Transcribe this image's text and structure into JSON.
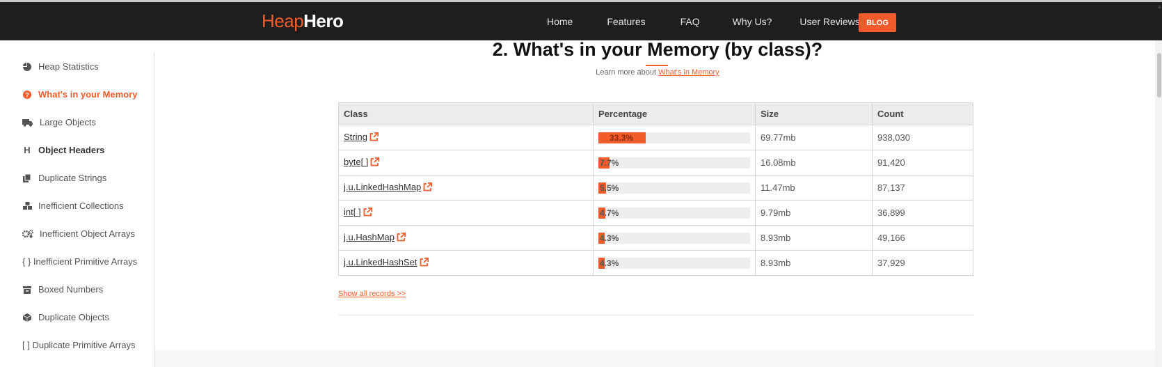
{
  "brand": {
    "part1": "Heap",
    "part2": "Hero"
  },
  "nav": {
    "items": [
      "Home",
      "Features",
      "FAQ",
      "Why Us?",
      "User Reviews"
    ],
    "blog": "BLOG"
  },
  "sidebar": {
    "items": [
      {
        "label": "Heap Statistics",
        "icon": "pie-chart-icon"
      },
      {
        "label": "What's in your Memory",
        "icon": "question-circle-icon",
        "active": true
      },
      {
        "label": "Large Objects",
        "icon": "truck-icon"
      },
      {
        "label": "Object Headers",
        "icon": "header-icon"
      },
      {
        "label": "Duplicate Strings",
        "icon": "copy-icon"
      },
      {
        "label": "Inefficient Collections",
        "icon": "cubes-icon"
      },
      {
        "label": "Inefficient Object Arrays",
        "icon": "gears-icon"
      },
      {
        "label": "{ } Inefficient Primitive Arrays",
        "icon": ""
      },
      {
        "label": "Boxed Numbers",
        "icon": "archive-icon"
      },
      {
        "label": "Duplicate Objects",
        "icon": "cube-icon"
      },
      {
        "label": "[ ] Duplicate Primitive Arrays",
        "icon": ""
      }
    ]
  },
  "section": {
    "title": "2. What's in your Memory (by class)?",
    "learn_prefix": "Learn more about",
    "learn_link": "What's in Memory"
  },
  "table": {
    "headers": [
      "Class",
      "Percentage",
      "Size",
      "Count"
    ],
    "rows": [
      {
        "cls": "String",
        "pct_label": "33.3%",
        "pct": 33.3,
        "size": "69.77mb",
        "count": "938,030"
      },
      {
        "cls": "byte[ ]",
        "pct_label": "7.7%",
        "pct": 7.7,
        "size": "16.08mb",
        "count": "91,420"
      },
      {
        "cls": "j.u.LinkedHashMap",
        "pct_label": "5.5%",
        "pct": 5.5,
        "size": "11.47mb",
        "count": "87,137"
      },
      {
        "cls": "int[ ]",
        "pct_label": "4.7%",
        "pct": 4.7,
        "size": "9.79mb",
        "count": "36,899"
      },
      {
        "cls": "j.u.HashMap",
        "pct_label": "4.3%",
        "pct": 4.3,
        "size": "8.93mb",
        "count": "49,166"
      },
      {
        "cls": "j.u.LinkedHashSet",
        "pct_label": "4.3%",
        "pct": 4.3,
        "size": "8.93mb",
        "count": "37,929"
      }
    ]
  },
  "show_all": "Show all records >>",
  "colors": {
    "accent": "#f25c2c",
    "topbar": "#1e1e1e"
  }
}
